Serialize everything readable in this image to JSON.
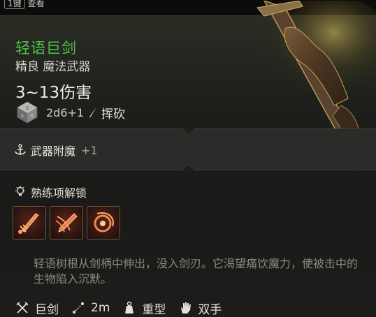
{
  "topbar": {
    "key": "1键",
    "label": "查看"
  },
  "item": {
    "name": "轻语巨剑",
    "subtitle": "精良 魔法武器",
    "damage": "3~13伤害",
    "dice": "2d6+1",
    "damage_type": "挥砍",
    "name_color": "#4fc24a"
  },
  "enchant": {
    "label": "武器附魔",
    "value": "+1",
    "icon": "anchor-icon"
  },
  "proficiency": {
    "label": "熟练项解锁",
    "icon": "lightbulb-icon",
    "skills": [
      "cleave-skill-icon",
      "lacerate-skill-icon",
      "pommel-strike-skill-icon"
    ]
  },
  "description": "轻语树根从剑柄中伸出，没入剑刃。它渴望痛饮魔力，使被击中的生物陷入沉默。",
  "properties": [
    {
      "icon": "crossed-swords-icon",
      "label": "巨剑"
    },
    {
      "icon": "range-icon",
      "label": "2m"
    },
    {
      "icon": "weight-icon",
      "label": "重型"
    },
    {
      "icon": "hand-icon",
      "label": "双手"
    }
  ]
}
